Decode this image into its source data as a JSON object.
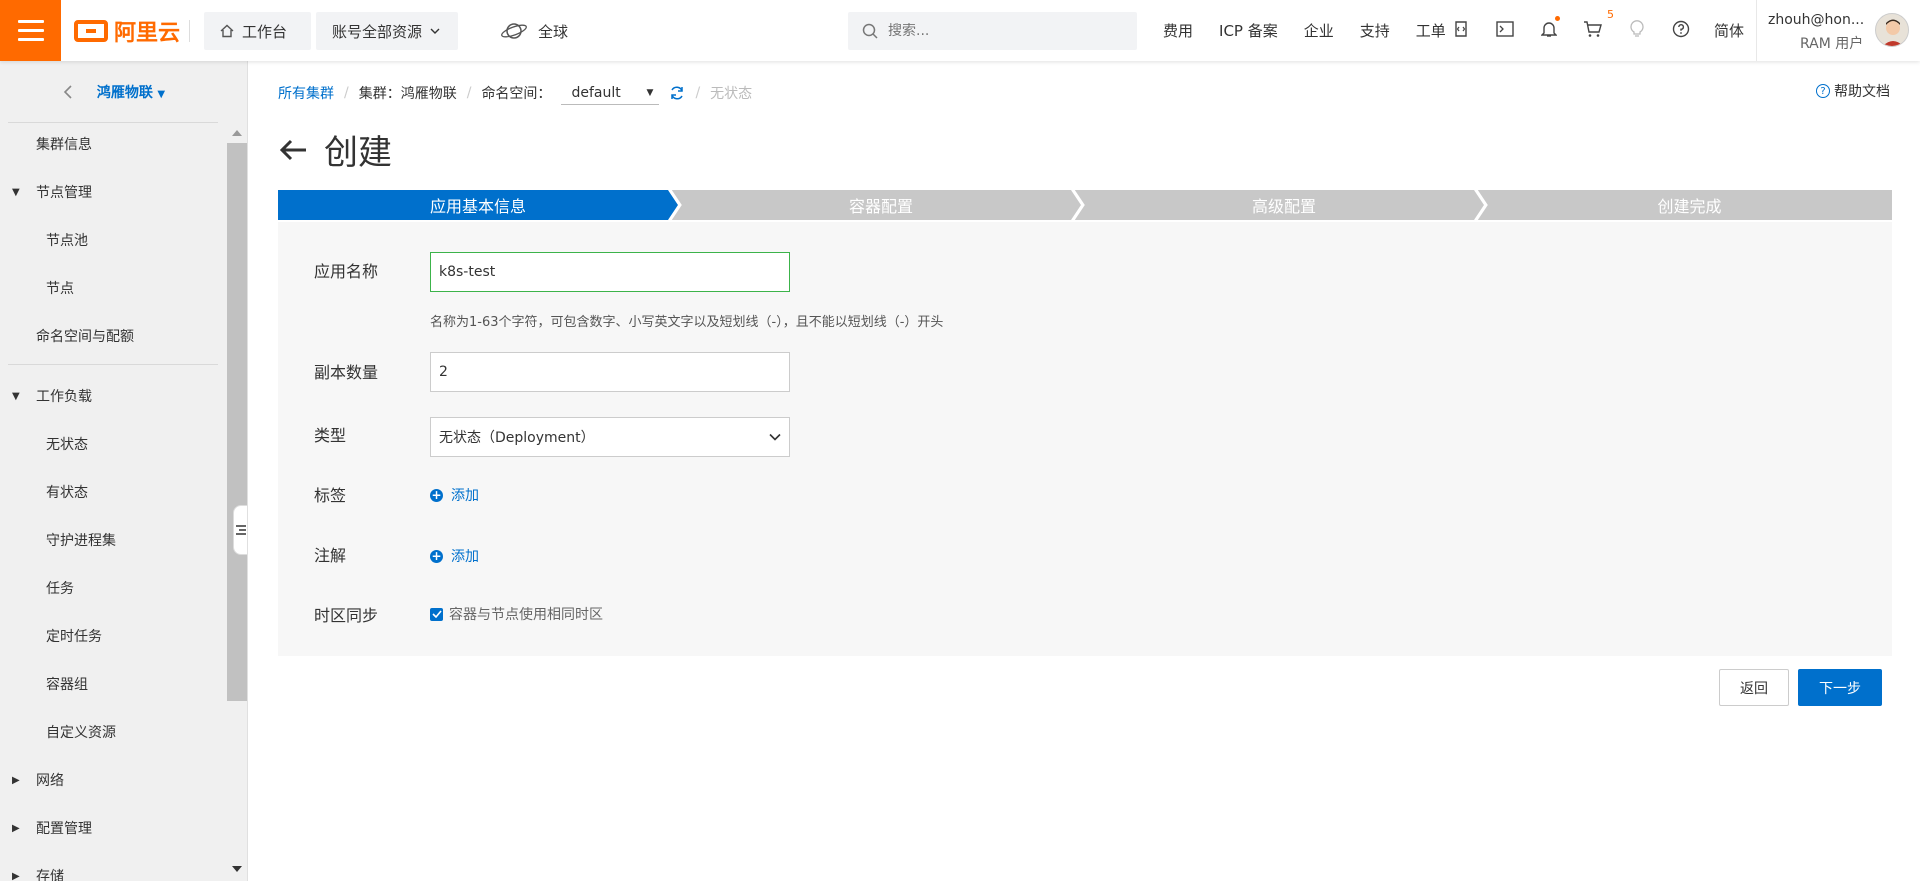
{
  "topbar": {
    "logo_text": "阿里云",
    "workbench": "工作台",
    "resources": "账号全部资源",
    "region": "全球",
    "search_placeholder": "搜索...",
    "links": [
      "费用",
      "ICP 备案",
      "企业",
      "支持",
      "工单"
    ],
    "cart_count": "5",
    "language": "简体",
    "user_name": "zhouh@hon...",
    "user_role": "RAM 用户",
    "accent": "#ff6a00"
  },
  "sidebar": {
    "cluster_name": "鸿雁物联",
    "items": [
      {
        "label": "集群信息",
        "level": 1
      },
      {
        "label": "节点管理",
        "level": 1,
        "caret": "down"
      },
      {
        "label": "节点池",
        "level": 2
      },
      {
        "label": "节点",
        "level": 2
      },
      {
        "label": "命名空间与配额",
        "level": 1
      },
      {
        "label": "工作负载",
        "level": 1,
        "caret": "down"
      },
      {
        "label": "无状态",
        "level": 2
      },
      {
        "label": "有状态",
        "level": 2
      },
      {
        "label": "守护进程集",
        "level": 2
      },
      {
        "label": "任务",
        "level": 2
      },
      {
        "label": "定时任务",
        "level": 2
      },
      {
        "label": "容器组",
        "level": 2
      },
      {
        "label": "自定义资源",
        "level": 2
      },
      {
        "label": "网络",
        "level": 1,
        "caret": "right"
      },
      {
        "label": "配置管理",
        "level": 1,
        "caret": "right"
      },
      {
        "label": "存储",
        "level": 1,
        "caret": "right"
      }
    ]
  },
  "breadcrumb": {
    "all_clusters": "所有集群",
    "cluster_label": "集群：鸿雁物联",
    "namespace_label": "命名空间：",
    "namespace_value": "default",
    "current": "无状态"
  },
  "help_label": "帮助文档",
  "page_title": "创建",
  "steps": [
    "应用基本信息",
    "容器配置",
    "高级配置",
    "创建完成"
  ],
  "active_step": 0,
  "form": {
    "app_name_label": "应用名称",
    "app_name_value": "k8s-test",
    "app_name_hint": "名称为1-63个字符，可包含数字、小写英文字以及短划线（-），且不能以短划线（-）开头",
    "replicas_label": "副本数量",
    "replicas_value": "2",
    "type_label": "类型",
    "type_value": "无状态（Deployment）",
    "labels_label": "标签",
    "labels_add": "添加",
    "annotations_label": "注解",
    "annotations_add": "添加",
    "timezone_label": "时区同步",
    "timezone_checkbox": "容器与节点使用相同时区",
    "timezone_checked": true
  },
  "buttons": {
    "back": "返回",
    "next": "下一步"
  },
  "colors": {
    "primary": "#0070cc",
    "step_inactive": "#c8c8c8",
    "input_active": "#3cb34a"
  }
}
